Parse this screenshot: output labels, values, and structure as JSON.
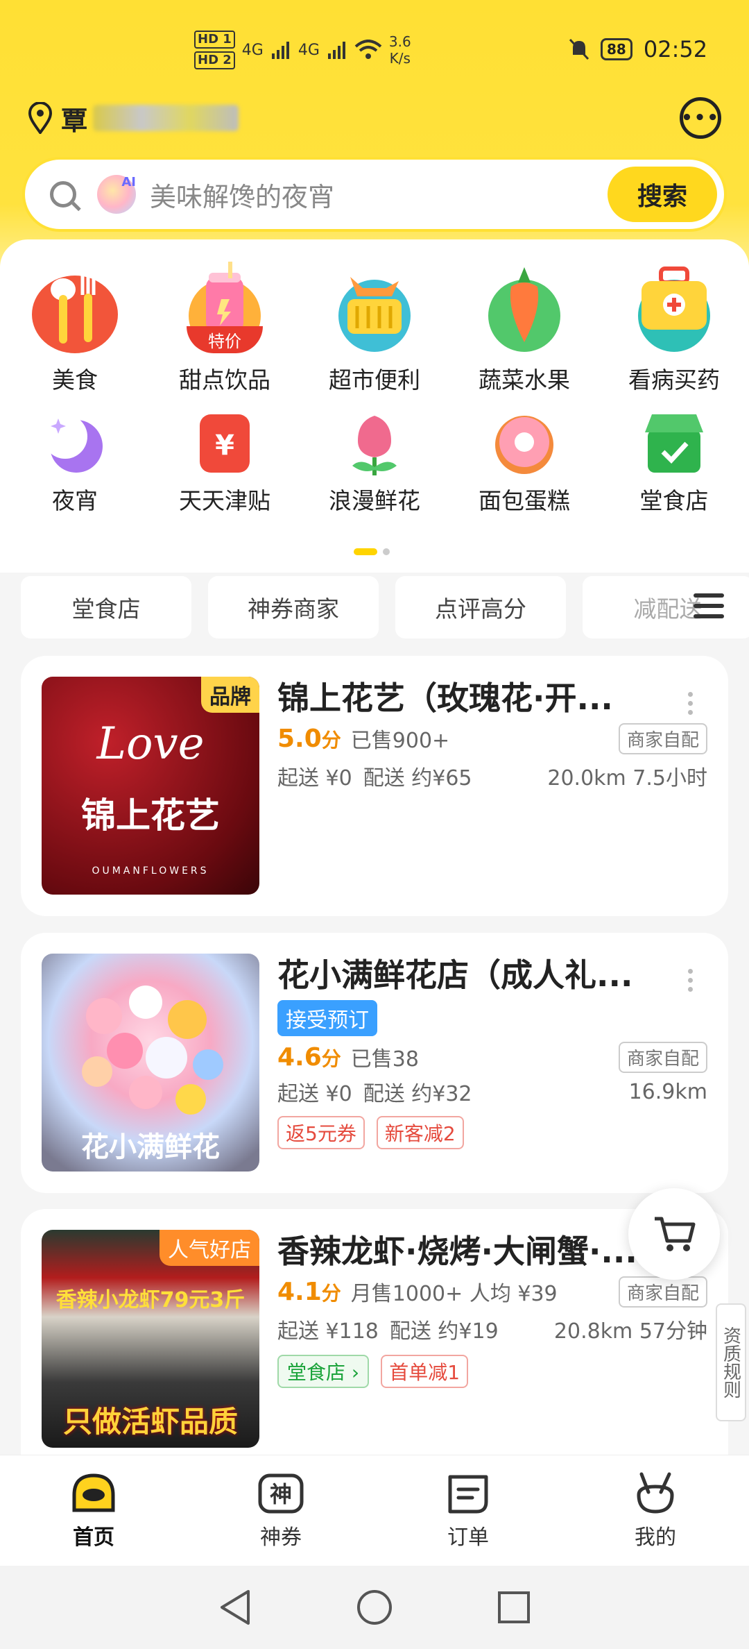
{
  "status_bar": {
    "hd1": "HD 1",
    "hd2": "HD 2",
    "net1": "4G",
    "net2": "4G",
    "speed_value": "3.6",
    "speed_unit": "K/s",
    "battery": "88",
    "time": "02:52"
  },
  "location": {
    "text": "覃",
    "message_icon": "chat-bubble-icon"
  },
  "search": {
    "placeholder": "美味解馋的夜宵",
    "ai_badge": "AI",
    "button": "搜索"
  },
  "categories": [
    {
      "label": "美食",
      "icon": "utensils-icon",
      "color": "#f2553a"
    },
    {
      "label": "甜点饮品",
      "icon": "drink-icon",
      "color": "#ffb13a",
      "badge": "特价"
    },
    {
      "label": "超市便利",
      "icon": "basket-icon",
      "color": "#3fbfd6"
    },
    {
      "label": "蔬菜水果",
      "icon": "carrot-icon",
      "color": "#52c86b"
    },
    {
      "label": "看病买药",
      "icon": "medkit-icon",
      "color": "#2ec0b6"
    },
    {
      "label": "夜宵",
      "icon": "moon-icon",
      "color": "#a874f0"
    },
    {
      "label": "天天津贴",
      "icon": "yen-bag-icon",
      "color": "#f0493a"
    },
    {
      "label": "浪漫鲜花",
      "icon": "flower-icon",
      "color": "#f06a8e"
    },
    {
      "label": "面包蛋糕",
      "icon": "donut-icon",
      "color": "#f48a3c"
    },
    {
      "label": "堂食店",
      "icon": "shop-icon",
      "color": "#2fb34d"
    }
  ],
  "filters": [
    "堂食店",
    "神券商家",
    "点评高分",
    "减配送"
  ],
  "stores": [
    {
      "name": "锦上花艺（玫瑰花·开...",
      "thumb_badge": "品牌",
      "thumb_text": "锦上花艺",
      "thumb_script": "Love",
      "thumb_sub": "OUMANFLOWERS",
      "score": "5.0",
      "score_unit": "分",
      "sold": "已售900+",
      "delivery_tag": "商家自配",
      "min_order": "起送 ¥0",
      "delivery_fee": "配送 约¥65",
      "distance_time": "20.0km  7.5小时"
    },
    {
      "name": "花小满鲜花店（成人礼...",
      "thumb_text": "花小满鲜花",
      "booking_tag": "接受预订",
      "score": "4.6",
      "score_unit": "分",
      "sold": "已售38",
      "delivery_tag": "商家自配",
      "min_order": "起送 ¥0",
      "delivery_fee": "配送 约¥32",
      "distance_time": "16.9km",
      "promos": [
        "返5元券",
        "新客减2"
      ]
    },
    {
      "name": "香辣龙虾·烧烤·大闸蟹·...",
      "thumb_badge": "人气好店",
      "thumb_sign": "香辣小龙虾79元3斤",
      "thumb_text": "只做活虾品质",
      "score": "4.1",
      "score_unit": "分",
      "sold": "月售1000+  人均 ¥39",
      "delivery_tag": "商家自配",
      "min_order": "起送 ¥118",
      "delivery_fee": "配送 约¥19",
      "distance_time": "20.8km  57分钟",
      "dinein_tag": "堂食店 ›",
      "promos": [
        "首单减1"
      ]
    }
  ],
  "qualification_tab": "资质规则",
  "bottom_nav": [
    {
      "label": "首页",
      "icon": "home-duck-icon",
      "active": true
    },
    {
      "label": "神券",
      "icon": "coupon-icon",
      "glyph": "神"
    },
    {
      "label": "订单",
      "icon": "order-icon"
    },
    {
      "label": "我的",
      "icon": "profile-icon"
    }
  ]
}
